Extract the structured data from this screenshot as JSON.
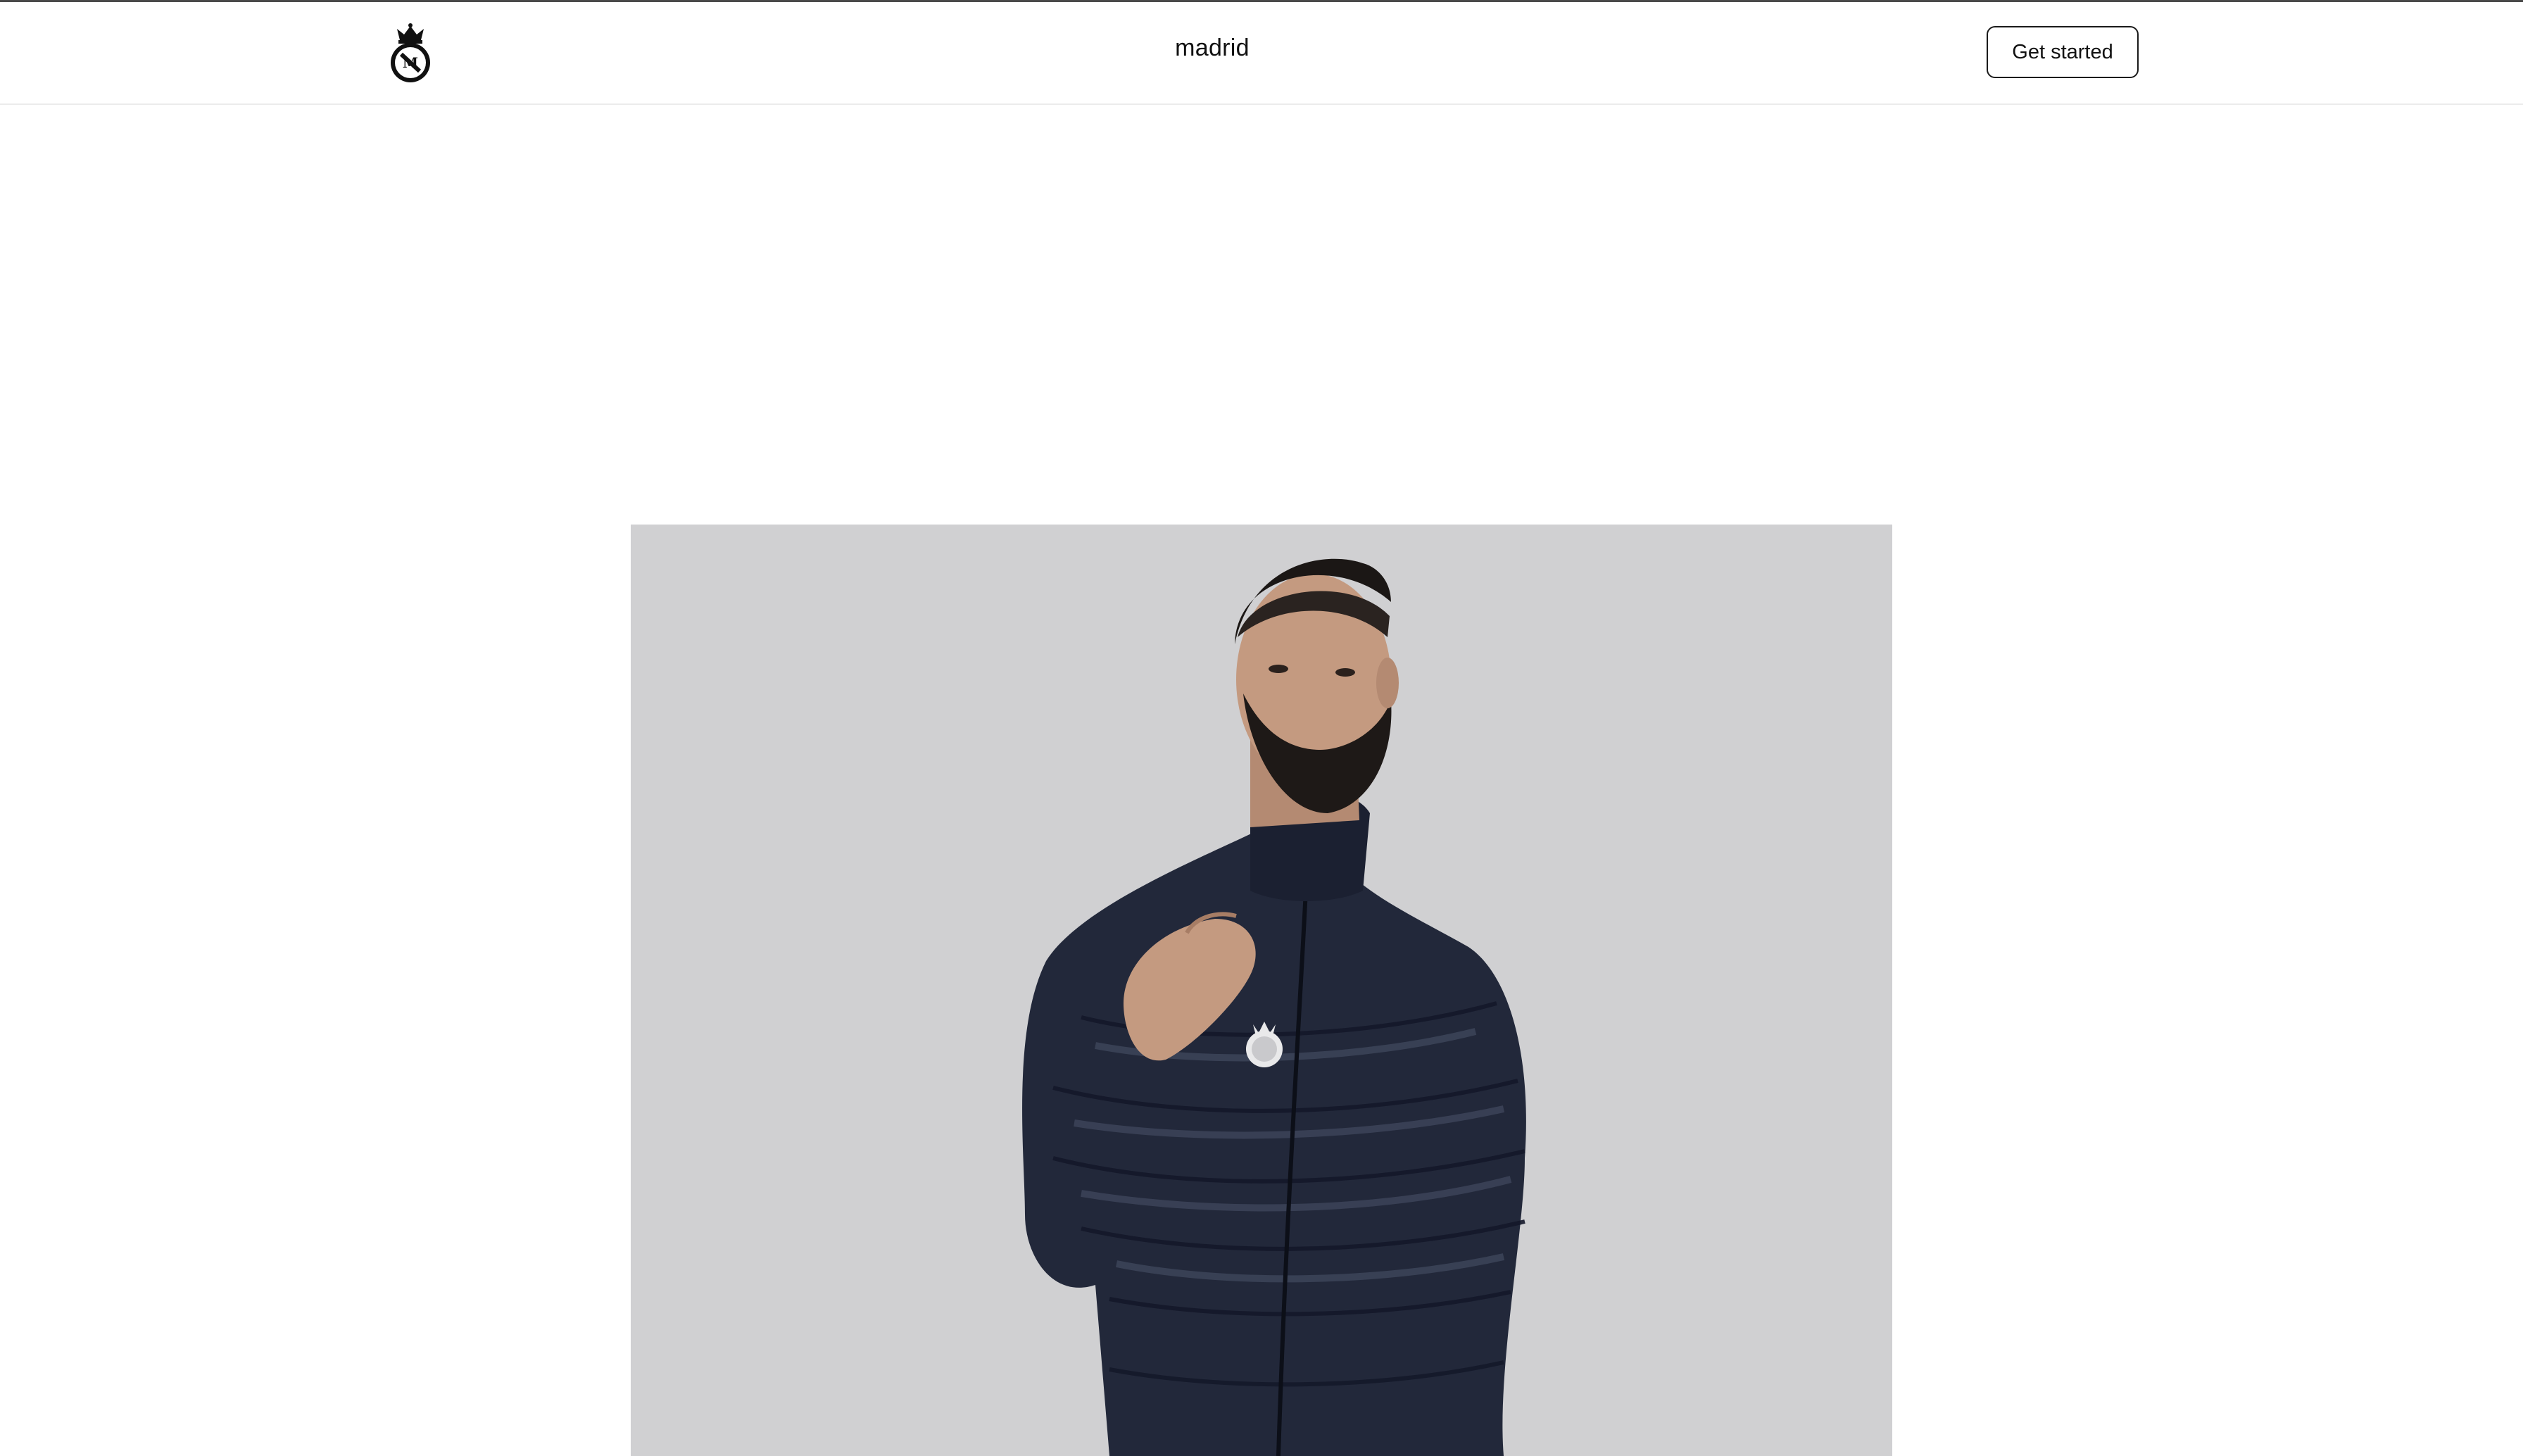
{
  "header": {
    "title": "madrid",
    "cta_label": "Get started",
    "logo_icon": "real-madrid-crest-icon"
  },
  "hero": {
    "image_subject": "man-in-navy-puffer-jacket",
    "background_color": "#d0d0d2",
    "jacket_color": "#22283a"
  },
  "colors": {
    "text": "#111111",
    "border": "#1a1a1a",
    "divider": "#ececec"
  }
}
